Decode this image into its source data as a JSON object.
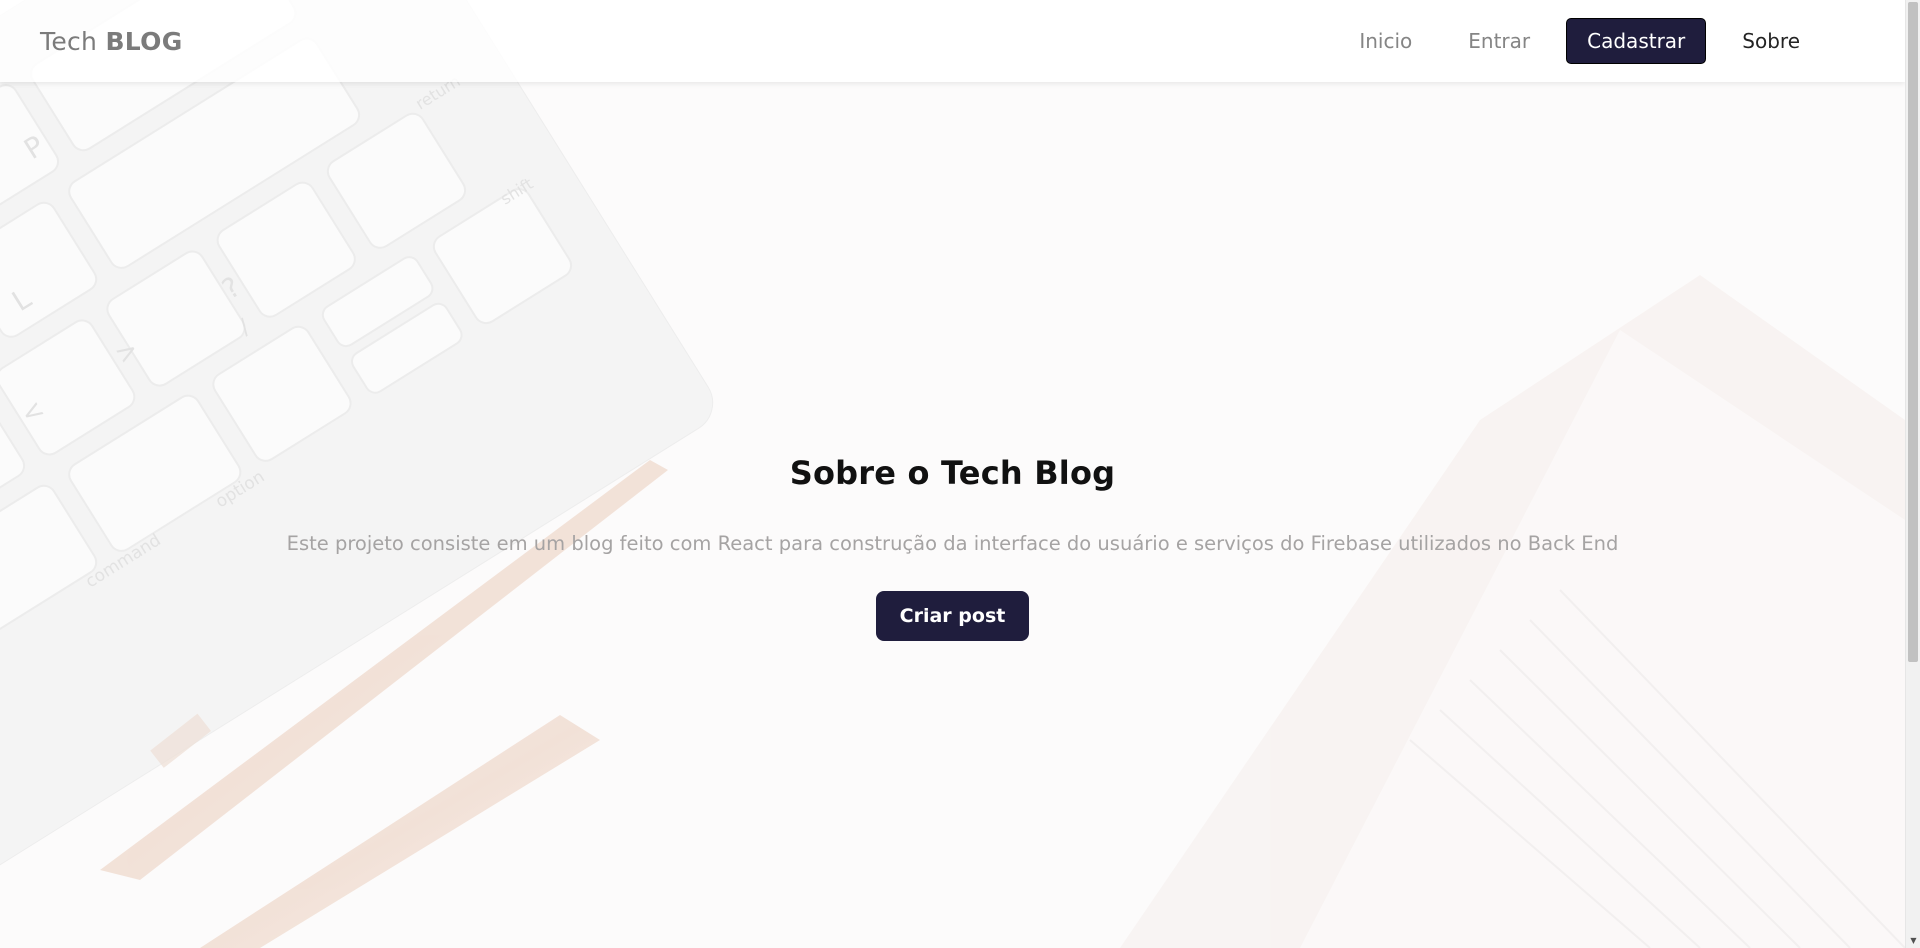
{
  "navbar": {
    "brand_light": "Tech ",
    "brand_bold": "BLOG",
    "links": [
      {
        "label": "Inicio"
      },
      {
        "label": "Entrar"
      },
      {
        "label": "Cadastrar"
      },
      {
        "label": "Sobre"
      }
    ]
  },
  "main": {
    "title": "Sobre o Tech Blog",
    "description": "Este projeto consiste em um blog feito com React para construção da interface do usuário e serviços do Firebase utilizados no Back End",
    "cta_label": "Criar post"
  },
  "background": {
    "key_labels": [
      "P",
      "L",
      "?",
      "/",
      ">",
      "<",
      "option",
      "command",
      "shift",
      "return"
    ]
  },
  "colors": {
    "accent": "#1f1d3d",
    "page_background": "#fcfbfb",
    "muted_text": "#a5a3a3"
  },
  "scrollbar": {
    "down_arrow": "▼"
  }
}
